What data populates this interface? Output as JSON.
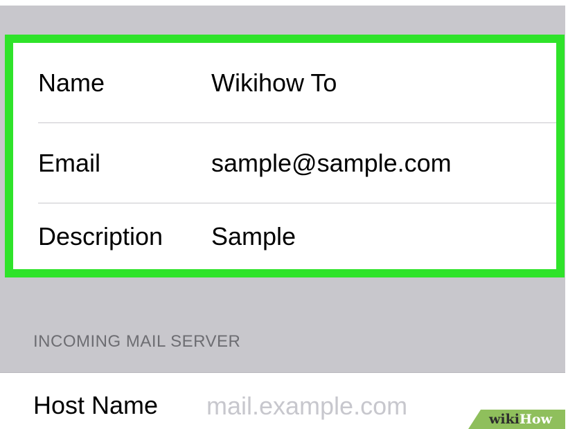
{
  "account_form": {
    "rows": [
      {
        "label": "Name",
        "value": "Wikihow To"
      },
      {
        "label": "Email",
        "value": "sample@sample.com"
      },
      {
        "label": "Description",
        "value": "Sample"
      }
    ],
    "highlight_color": "#2fe32a"
  },
  "incoming_server": {
    "section_title": "INCOMING MAIL SERVER",
    "host_name_label": "Host Name",
    "host_name_placeholder": "mail.example.com"
  },
  "watermark": {
    "wiki": "wiki",
    "how": "How",
    "color": "#8fbf5c"
  },
  "colors": {
    "background": "#c8c7cc",
    "section_text": "#6d6d72",
    "placeholder": "#c7c7cd"
  }
}
